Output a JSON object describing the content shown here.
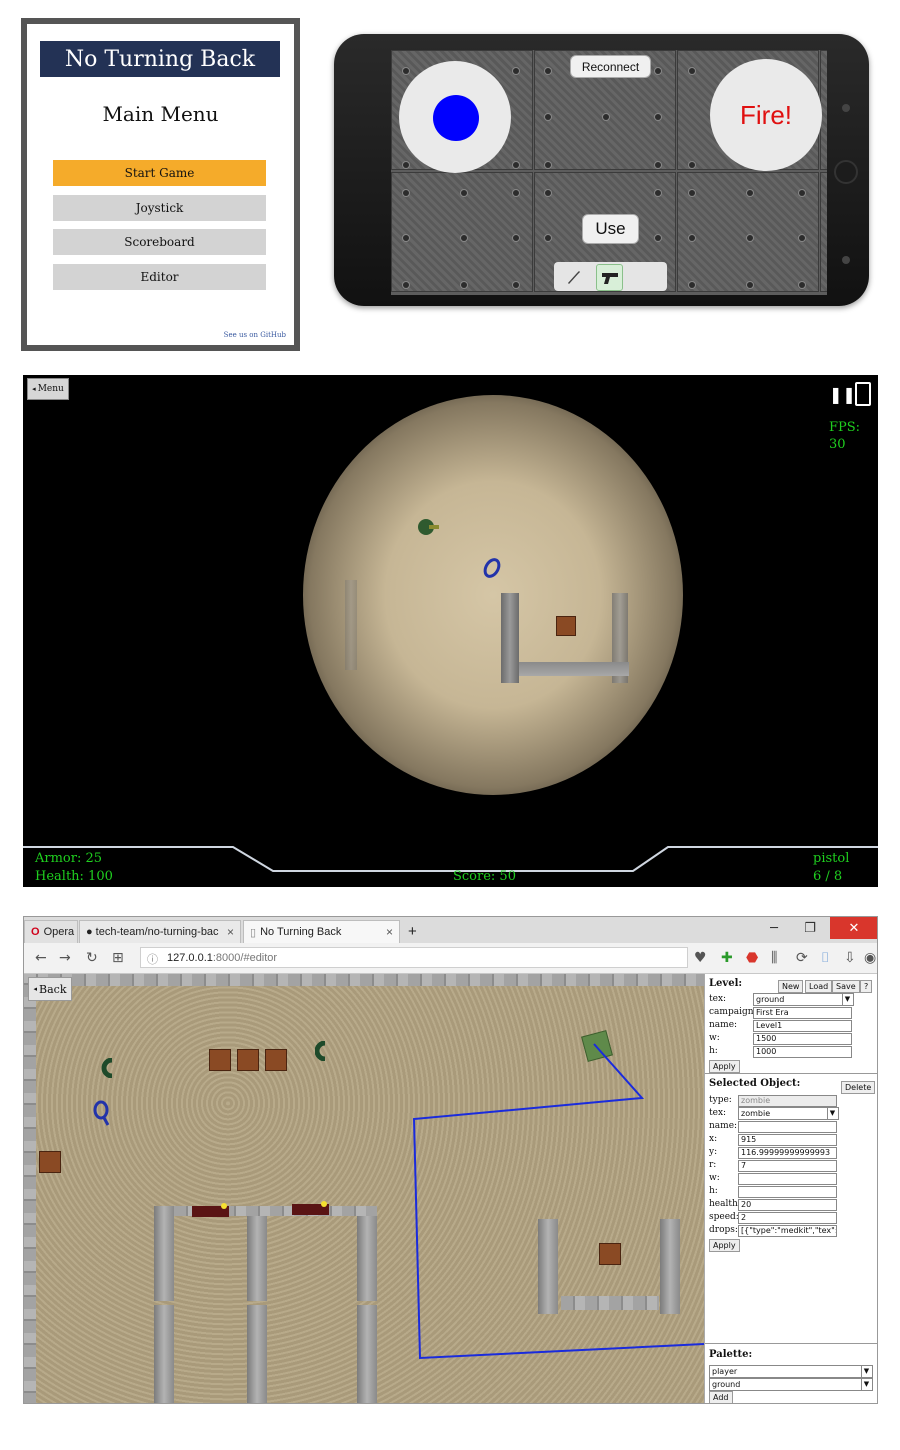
{
  "menu": {
    "title": "No Turning Back",
    "subtitle": "Main Menu",
    "buttons": [
      "Start Game",
      "Joystick",
      "Scoreboard",
      "Editor"
    ],
    "footer": "See us on GitHub",
    "colors": {
      "title_bg": "#233255",
      "primary_btn": "#f5ab2a",
      "btn": "#d3d3d3"
    }
  },
  "controller": {
    "reconnect_label": "Reconnect",
    "fire_label": "Fire!",
    "use_label": "Use",
    "weapons": [
      "knife-icon",
      "pistol-icon"
    ],
    "selected_weapon": "pistol-icon",
    "colors": {
      "joystick_knob": "#0000ff",
      "fire_text": "#e01010"
    }
  },
  "game": {
    "menu_label": "Menu",
    "fps": "FPS: 30",
    "armor": "Armor: 25",
    "health": "Health: 100",
    "score": "Score: 50",
    "weapon": "pistol",
    "ammo": "6 / 8",
    "icons": [
      "pause-icon",
      "phone-icon"
    ],
    "hud_color": "#1fcf1f"
  },
  "browser": {
    "tabs": [
      {
        "label": "Opera"
      },
      {
        "label": "tech-team/no-turning-bac"
      },
      {
        "label": "No Turning Back"
      }
    ],
    "new_tab": "+",
    "url_host": "127.0.0.1",
    "url_path": ":8000/#editor"
  },
  "editor": {
    "back_label": "Back",
    "level": {
      "title": "Level:",
      "buttons": [
        "New",
        "Load",
        "Save",
        "?"
      ],
      "fields": [
        {
          "label": "tex:",
          "value": "ground",
          "kind": "select"
        },
        {
          "label": "campaign:",
          "value": "First Era"
        },
        {
          "label": "name:",
          "value": "Level1"
        },
        {
          "label": "w:",
          "value": "1500"
        },
        {
          "label": "h:",
          "value": "1000"
        }
      ],
      "apply": "Apply"
    },
    "selected": {
      "title": "Selected Object:",
      "delete": "Delete",
      "fields": [
        {
          "label": "type:",
          "value": "zombie"
        },
        {
          "label": "tex:",
          "value": "zombie",
          "kind": "select"
        },
        {
          "label": "name:",
          "value": ""
        },
        {
          "label": "x:",
          "value": "915"
        },
        {
          "label": "y:",
          "value": "116.99999999999993"
        },
        {
          "label": "r:",
          "value": "7"
        },
        {
          "label": "w:",
          "value": ""
        },
        {
          "label": "h:",
          "value": ""
        },
        {
          "label": "health:",
          "value": "20"
        },
        {
          "label": "speed:",
          "value": "2"
        },
        {
          "label": "drops:",
          "value": "[{\"type\":\"medkit\",\"tex\":\"gold"
        }
      ],
      "apply": "Apply"
    },
    "palette": {
      "title": "Palette:",
      "selects": [
        "player",
        "ground"
      ],
      "add": "Add"
    },
    "path_color": "#1a2bdd"
  }
}
